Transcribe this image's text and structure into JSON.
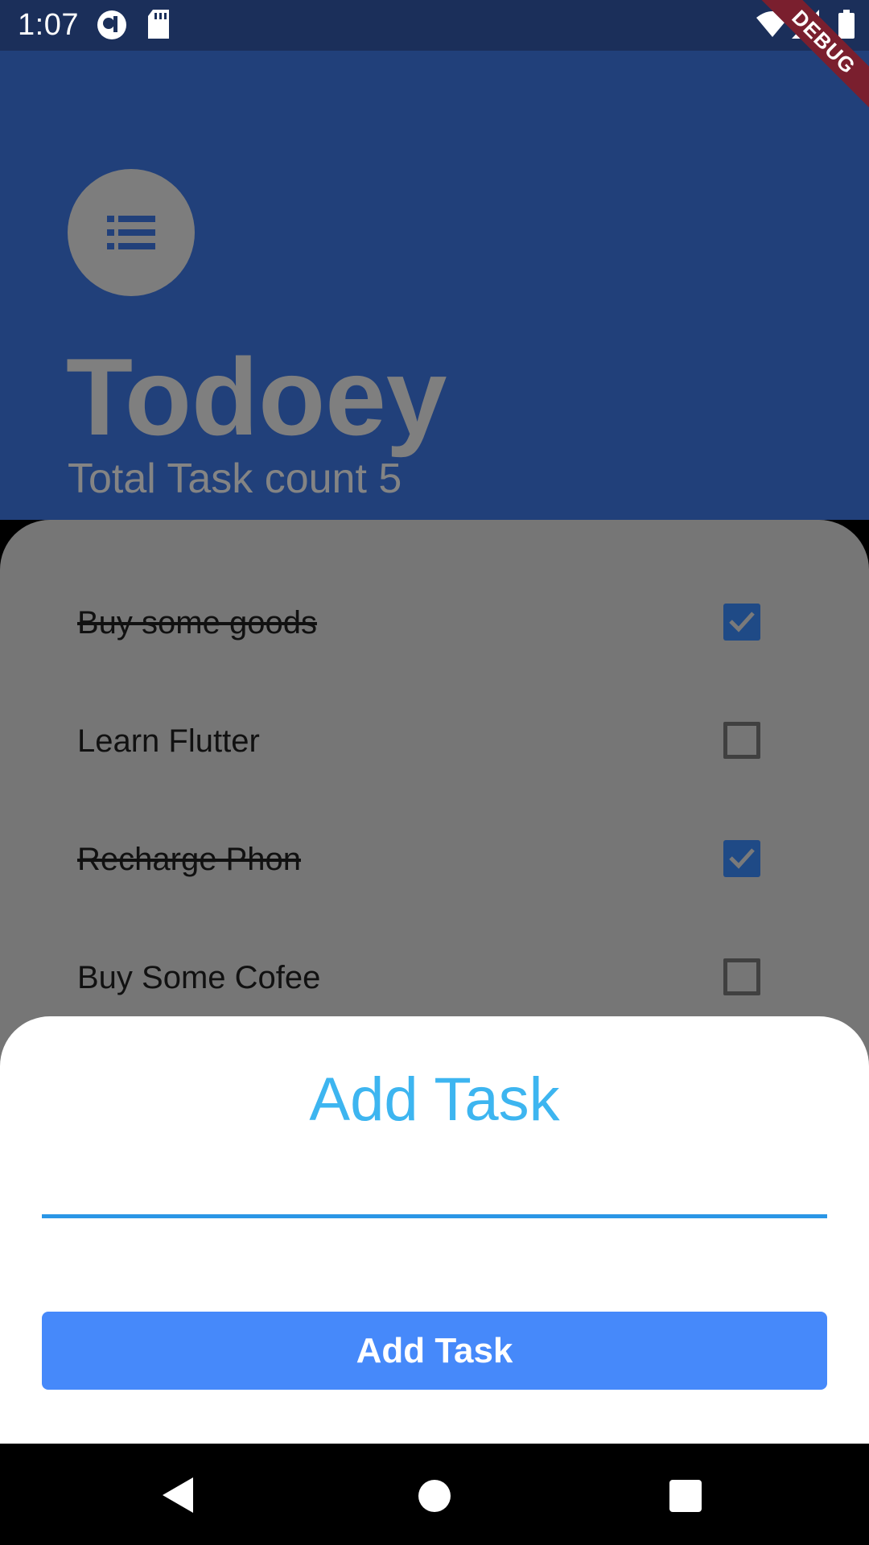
{
  "status_bar": {
    "time": "1:07"
  },
  "debug_banner": "DEBUG",
  "header": {
    "title": "Todoey",
    "task_count": "Total Task count 5"
  },
  "tasks": [
    {
      "label": "Buy  some goods",
      "done": true
    },
    {
      "label": "Learn Flutter",
      "done": false
    },
    {
      "label": "Recharge Phon",
      "done": true
    },
    {
      "label": "Buy Some Cofee",
      "done": false
    }
  ],
  "sheet": {
    "title": "Add Task",
    "input_value": "",
    "button_label": "Add Task"
  },
  "colors": {
    "header_bg": "#21407a",
    "accent": "#3db5f0",
    "button": "#4689fa",
    "checkbox_checked": "#1f4a86"
  }
}
